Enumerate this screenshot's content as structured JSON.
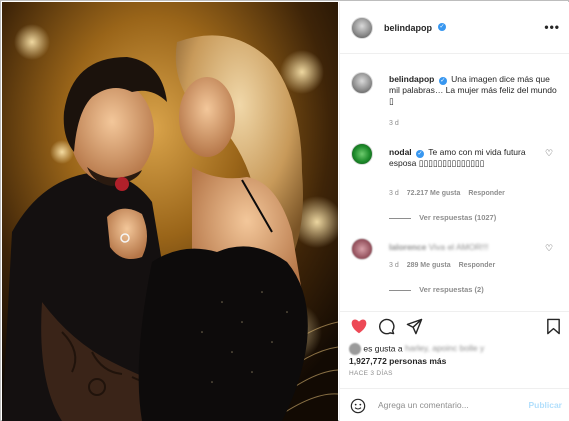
{
  "post": {
    "username": "belindapop",
    "more_label": "•••"
  },
  "caption": {
    "username": "belindapop",
    "text": "Una imagen dice más que mil palabras… La mujer más feliz del mundo",
    "emoji": "▯",
    "time": "3 d"
  },
  "comments": [
    {
      "username": "nodal",
      "text": "Te amo con mi vida futura esposa",
      "emoji": "▯▯▯▯▯▯▯▯▯▯▯▯▯▯",
      "time": "3 d",
      "likes": "72.217 Me gusta",
      "reply_label": "Responder",
      "view_replies": "Ver respuestas (1027)"
    },
    {
      "username": "lalorence",
      "text": "Viva el AMOR!!!",
      "time": "3 d",
      "likes": "289 Me gusta",
      "reply_label": "Responder",
      "view_replies": "Ver respuestas (2)"
    }
  ],
  "likes": {
    "prefix": "es gusta a",
    "names": "harley, apoinc bolle y",
    "count_line": "1,927,772 personas más"
  },
  "date": "HACE 3 DÍAS",
  "add_comment": {
    "placeholder": "Agrega un comentario...",
    "publish": "Publicar"
  },
  "colors": {
    "verified": "#3897f0",
    "like_red": "#ed4956",
    "muted": "#8e8e8e",
    "publish_disabled": "#b2dffc"
  }
}
